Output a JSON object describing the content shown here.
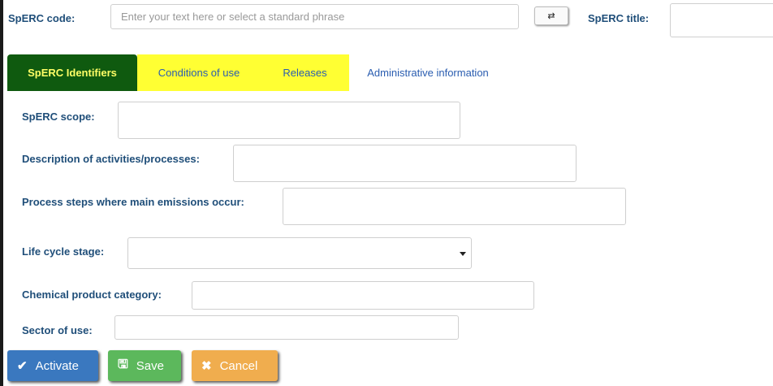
{
  "header": {
    "code_label": "SpERC code:",
    "code_placeholder": "Enter your text here or select a standard phrase",
    "code_value": "",
    "swap_icon": "⇄",
    "title_label": "SpERC title:",
    "title_value": ""
  },
  "tabs": [
    {
      "label": "SpERC Identifiers"
    },
    {
      "label": "Conditions of use"
    },
    {
      "label": "Releases"
    },
    {
      "label": "Administrative information"
    }
  ],
  "form": {
    "scope_label": "SpERC scope:",
    "description_label": "Description of activities/processes:",
    "process_steps_label": "Process steps where main emissions occur:",
    "life_cycle_label": "Life cycle stage:",
    "life_cycle_value": "",
    "chemical_category_label": "Chemical product category:",
    "sector_label": "Sector of use:"
  },
  "buttons": {
    "activate_icon": "✔",
    "activate_label": "Activate",
    "save_icon": "🖫",
    "save_label": "Save",
    "cancel_icon": "✖",
    "cancel_label": "Cancel"
  },
  "colors": {
    "label": "#1f4e79",
    "tab_active_bg": "#0f5a0f",
    "tab_active_text": "#ffff66",
    "tab_highlight_bg": "#ffff33",
    "tab_text": "#2a5db0",
    "activate": "#3a78bf",
    "save": "#5cb85c",
    "cancel": "#f0ad4e"
  }
}
